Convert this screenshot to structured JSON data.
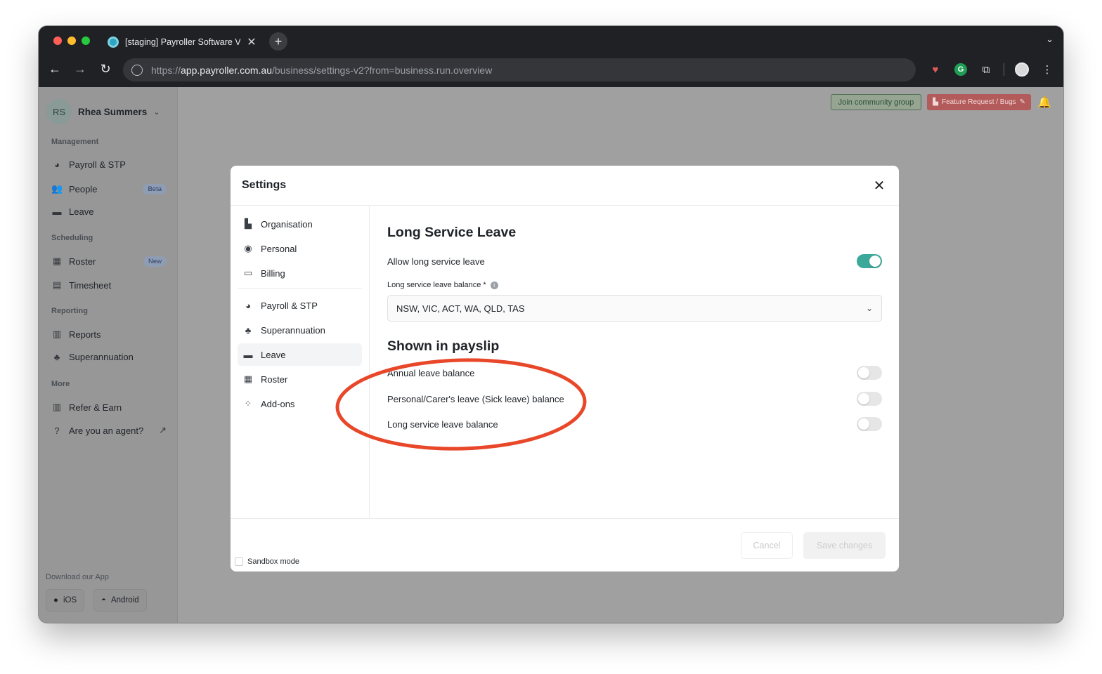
{
  "browser": {
    "tab_title": "[staging] Payroller Software V",
    "url_scheme": "https://",
    "url_host": "app.payroller.com.au",
    "url_path": "/business/settings-v2?from=business.run.overview",
    "colors": {
      "close": "#ff5f57",
      "minimize": "#febc2e",
      "zoom": "#28c840"
    }
  },
  "sidebar": {
    "user_initials": "RS",
    "user_name": "Rhea Summers",
    "sections": {
      "management": "Management",
      "scheduling": "Scheduling",
      "reporting": "Reporting",
      "more": "More"
    },
    "items": {
      "payroll": "Payroll & STP",
      "people": "People",
      "people_badge": "Beta",
      "leave": "Leave",
      "roster": "Roster",
      "roster_badge": "New",
      "timesheet": "Timesheet",
      "reports": "Reports",
      "superannuation": "Superannuation",
      "refer": "Refer & Earn",
      "agent": "Are you an agent?"
    },
    "download_label": "Download our App",
    "ios": "iOS",
    "android": "Android"
  },
  "topbar": {
    "community": "Join community group",
    "feature": "Feature Request / Bugs"
  },
  "modal": {
    "title": "Settings",
    "nav": {
      "organisation": "Organisation",
      "personal": "Personal",
      "billing": "Billing",
      "payroll": "Payroll & STP",
      "superannuation": "Superannuation",
      "leave": "Leave",
      "roster": "Roster",
      "addons": "Add-ons"
    },
    "lsl": {
      "heading": "Long Service Leave",
      "allow_label": "Allow long service leave",
      "allow_on": true,
      "balance_label": "Long service leave balance *",
      "balance_value": "NSW, VIC, ACT, WA, QLD, TAS"
    },
    "payslip": {
      "heading": "Shown in payslip",
      "annual": "Annual leave balance",
      "personal": "Personal/Carer's leave (Sick leave) balance",
      "long_service": "Long service leave balance"
    },
    "footer": {
      "sandbox": "Sandbox mode",
      "cancel": "Cancel",
      "save": "Save changes"
    }
  },
  "annotation_color": "#e8472a"
}
